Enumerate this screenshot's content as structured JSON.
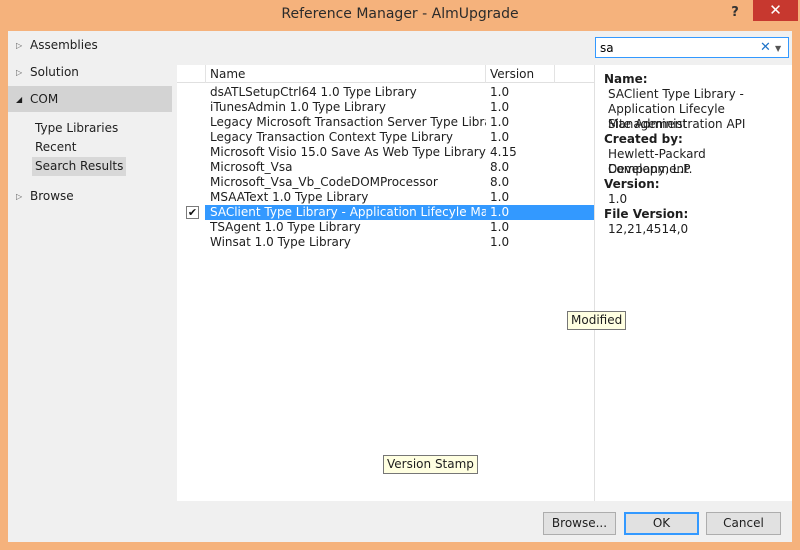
{
  "window": {
    "title": "Reference Manager - AlmUpgrade",
    "help": "?",
    "close": "✕"
  },
  "nav": {
    "items": [
      {
        "label": "Assemblies",
        "arrow": "▷"
      },
      {
        "label": "Solution",
        "arrow": "▷"
      },
      {
        "label": "COM",
        "arrow": "◢"
      },
      {
        "label": "Browse",
        "arrow": "▷"
      }
    ],
    "com_sub": [
      "Type Libraries",
      "Recent",
      "Search Results"
    ],
    "selected_sub": "Search Results"
  },
  "search": {
    "value": "sa",
    "clear_icon": "✕",
    "dropdown_icon": "▼"
  },
  "list": {
    "columns": [
      "Name",
      "Version"
    ],
    "rows": [
      {
        "name": "dsATLSetupCtrl64 1.0 Type Library",
        "version": "1.0",
        "checked": false
      },
      {
        "name": "iTunesAdmin 1.0 Type Library",
        "version": "1.0",
        "checked": false
      },
      {
        "name": "Legacy Microsoft Transaction Server Type Library",
        "version": "1.0",
        "checked": false
      },
      {
        "name": "Legacy Transaction Context Type Library",
        "version": "1.0",
        "checked": false
      },
      {
        "name": "Microsoft Visio 15.0 Save As Web Type Library",
        "version": "4.15",
        "checked": false
      },
      {
        "name": "Microsoft_Vsa",
        "version": "8.0",
        "checked": false
      },
      {
        "name": "Microsoft_Vsa_Vb_CodeDOMProcessor",
        "version": "8.0",
        "checked": false
      },
      {
        "name": "MSAAText 1.0 Type Library",
        "version": "1.0",
        "checked": false
      },
      {
        "name": "SAClient Type Library - Application Lifecyle Man...",
        "version": "1.0",
        "checked": true
      },
      {
        "name": "TSAgent 1.0 Type Library",
        "version": "1.0",
        "checked": false
      },
      {
        "name": "Winsat 1.0 Type Library",
        "version": "1.0",
        "checked": false
      }
    ],
    "check_glyph": "✔"
  },
  "details": {
    "name_label": "Name:",
    "name_lines": [
      "SAClient Type Library -",
      "Application Lifecyle Management",
      "Site Administration API"
    ],
    "created_label": "Created by:",
    "created_lines": [
      "Hewlett-Packard Development",
      "Company, L.P."
    ],
    "version_label": "Version:",
    "version_value": "1.0",
    "file_version_label": "File Version:",
    "file_version_value": "12,21,4514,0"
  },
  "tooltips": {
    "modified": "Modified",
    "version_stamp": "Version Stamp"
  },
  "buttons": {
    "browse": "Browse...",
    "ok": "OK",
    "cancel": "Cancel"
  },
  "colors": {
    "titlebar": "#f5b27c",
    "close": "#c7382f",
    "selection": "#3399ff"
  }
}
